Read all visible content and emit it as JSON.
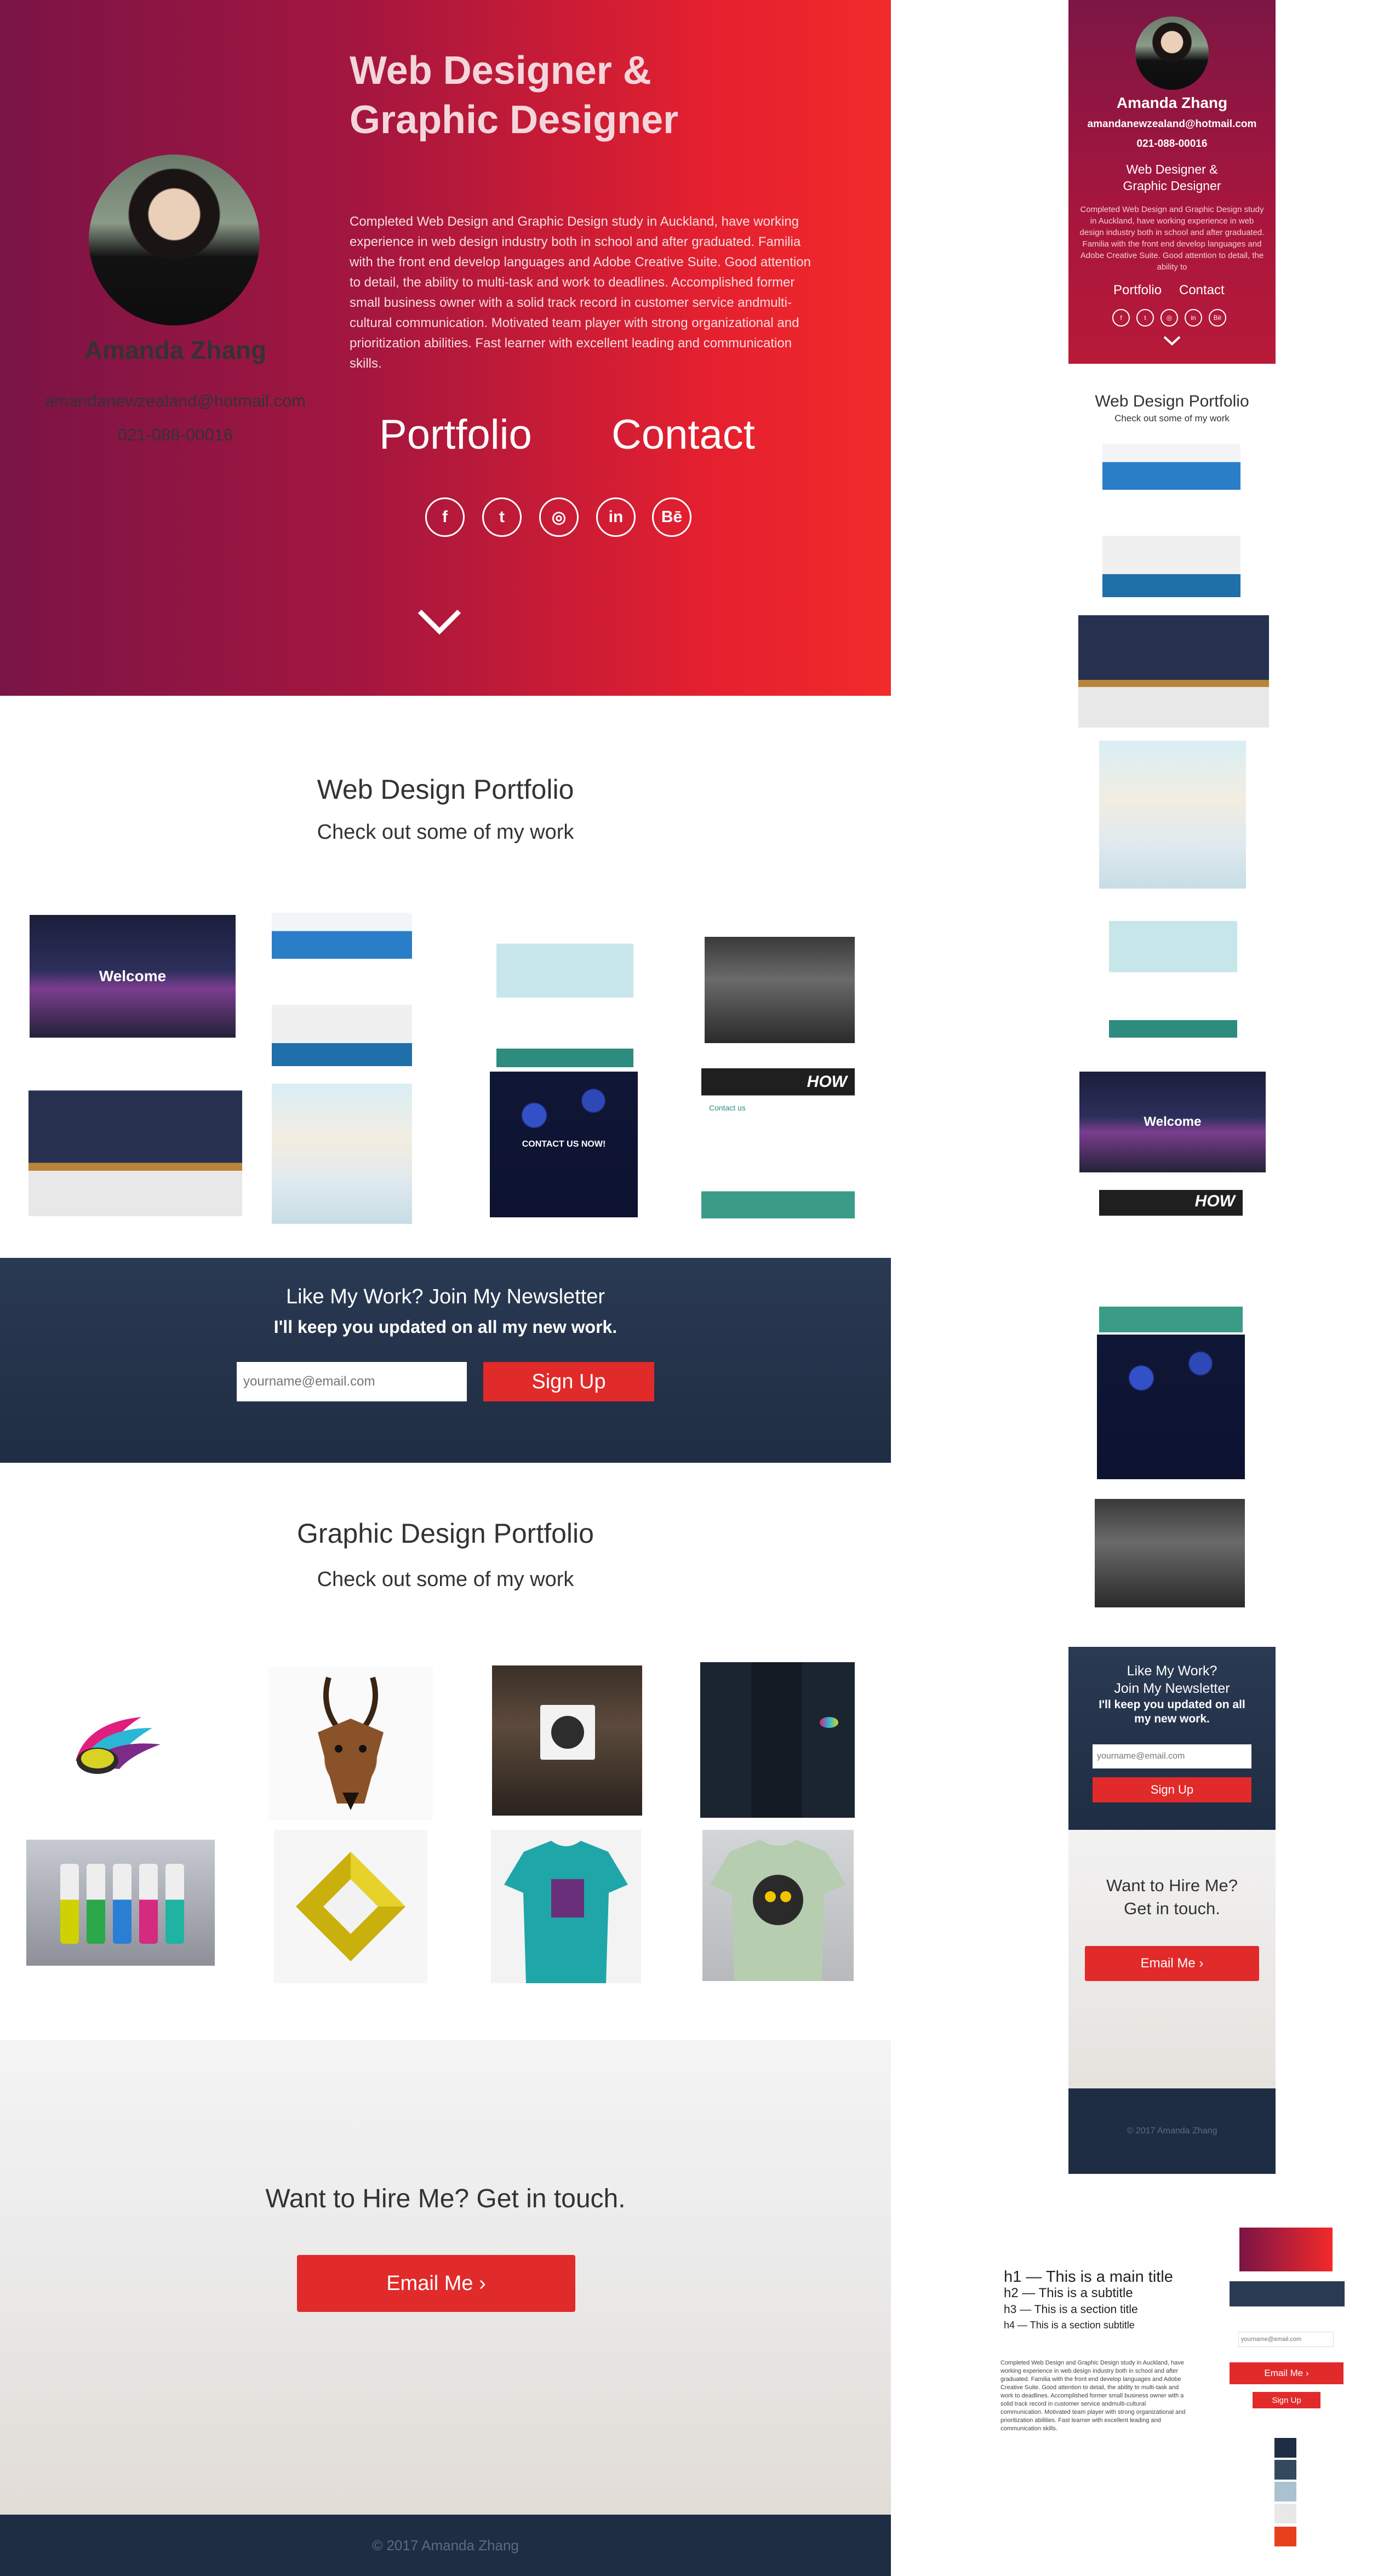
{
  "desktop": {
    "hero": {
      "name": "Amanda Zhang",
      "email": "amandanewzealand@hotmail.com",
      "phone": "021-088-00016",
      "title_line1": "Web Designer &",
      "title_line2": "Graphic Designer",
      "bio": "Completed Web Design and Graphic Design study in Auckland, have working experience in web design industry both in school and after graduated. Familia with the front end develop languages and Adobe Creative Suite. Good attention to detail, the ability to multi-task and work to deadlines. Accomplished former small business owner with a solid track record in customer service andmulti-cultural communication. Motivated  team player with strong organizational  and prioritization abilities. Fast learner with excellent leading and communication skills.",
      "nav_portfolio": "Portfolio",
      "nav_contact": "Contact",
      "social": [
        {
          "icon": "facebook-icon",
          "glyph": "f"
        },
        {
          "icon": "twitter-icon",
          "glyph": "t"
        },
        {
          "icon": "dribbble-icon",
          "glyph": "◎"
        },
        {
          "icon": "linkedin-icon",
          "glyph": "in"
        },
        {
          "icon": "behance-icon",
          "glyph": "Bē"
        }
      ]
    },
    "web_portfolio": {
      "heading": "Web Design Portfolio",
      "subheading": "Check out some of my work",
      "thumb_welcome_label": "Welcome",
      "thumb_contact_label": "CONTACT US NOW!",
      "thumb_contact2_label": "HOW",
      "thumb_contact3_label": "Contact us"
    },
    "newsletter": {
      "heading": "Like My Work? Join My Newsletter",
      "subheading": "I'll keep you updated on all my new work.",
      "input_placeholder": "yourname@email.com",
      "button": "Sign Up"
    },
    "graphic_portfolio": {
      "heading": "Graphic Design Portfolio",
      "subheading": "Check out some of my work"
    },
    "hire": {
      "heading": "Want to Hire Me? Get in touch.",
      "button": "Email Me ›"
    },
    "footer": "© 2017 Amanda Zhang"
  },
  "mobile": {
    "name": "Amanda Zhang",
    "email": "amandanewzealand@hotmail.com",
    "phone": "021-088-00016",
    "title_line1": "Web Designer &",
    "title_line2": "Graphic Designer",
    "bio": "Completed Web Design and Graphic Design study in Auckland, have working experience in web design industry both in school and after graduated. Familia with the front end develop languages and Adobe Creative Suite. Good attention to detail, the ability to",
    "nav_portfolio": "Portfolio",
    "nav_contact": "Contact",
    "web_heading": "Web Design Portfolio",
    "web_subheading": "Check out some of my work",
    "thumb_welcome_label": "Welcome",
    "thumb_how_label": "HOW",
    "news_line1": "Like My Work?",
    "news_line2": "Join My Newsletter",
    "news_line3": "I'll keep you updated on all",
    "news_line4": "my new work.",
    "news_placeholder": "yourname@email.com",
    "news_button": "Sign Up",
    "hire_line1": "Want to Hire Me?",
    "hire_line2": "Get in touch.",
    "hire_button": "Email Me ›",
    "footer": "© 2017 Amanda Zhang"
  },
  "style_guide": {
    "h1": "h1 — This is a main title",
    "h2": "h2 — This is a subtitle",
    "h3": "h3 — This is a section title",
    "h4": "h4 — This is a section subtitle",
    "body": "Completed Web Design and Graphic Design study in Auckland, have working experience in web design industry both in school and after graduated. Familia with the front end develop languages and Adobe Creative Suite. Good attention to detail, the ability to multi-task and work to deadlines. Accomplished former small business owner with a solid track record in customer service andmulti-cultural communication. Motivated team player with strong organizational and prioritization abilities. Fast learner with excellent leading and communication skills.",
    "input_placeholder": "yourname@email.com",
    "button_email": "Email Me ›",
    "button_signup": "Sign Up",
    "swatches": [
      "#1f2d44",
      "#34495e",
      "#a8c3cf",
      "#e8e8e8",
      "#e8401c"
    ]
  },
  "colors": {
    "brand_red": "#e12a2a",
    "brand_plum": "#7a1446",
    "navy": "#1f2d44"
  }
}
